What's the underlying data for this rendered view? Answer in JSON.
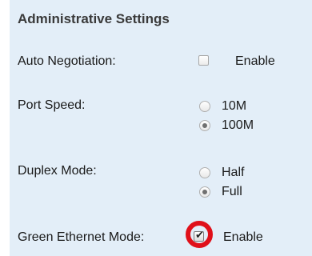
{
  "section": {
    "title": "Administrative Settings"
  },
  "auto_negotiation": {
    "label": "Auto Negotiation:",
    "option_label": "Enable",
    "checked": false
  },
  "port_speed": {
    "label": "Port Speed:",
    "options": [
      {
        "label": "10M",
        "selected": false
      },
      {
        "label": "100M",
        "selected": true
      }
    ]
  },
  "duplex_mode": {
    "label": "Duplex Mode:",
    "options": [
      {
        "label": "Half",
        "selected": false
      },
      {
        "label": "Full",
        "selected": true
      }
    ]
  },
  "green_ethernet": {
    "label": "Green Ethernet Mode:",
    "option_label": "Enable",
    "checked": true
  },
  "colors": {
    "panel_background": "#e3eef8",
    "highlight_ring": "#e0101a"
  }
}
